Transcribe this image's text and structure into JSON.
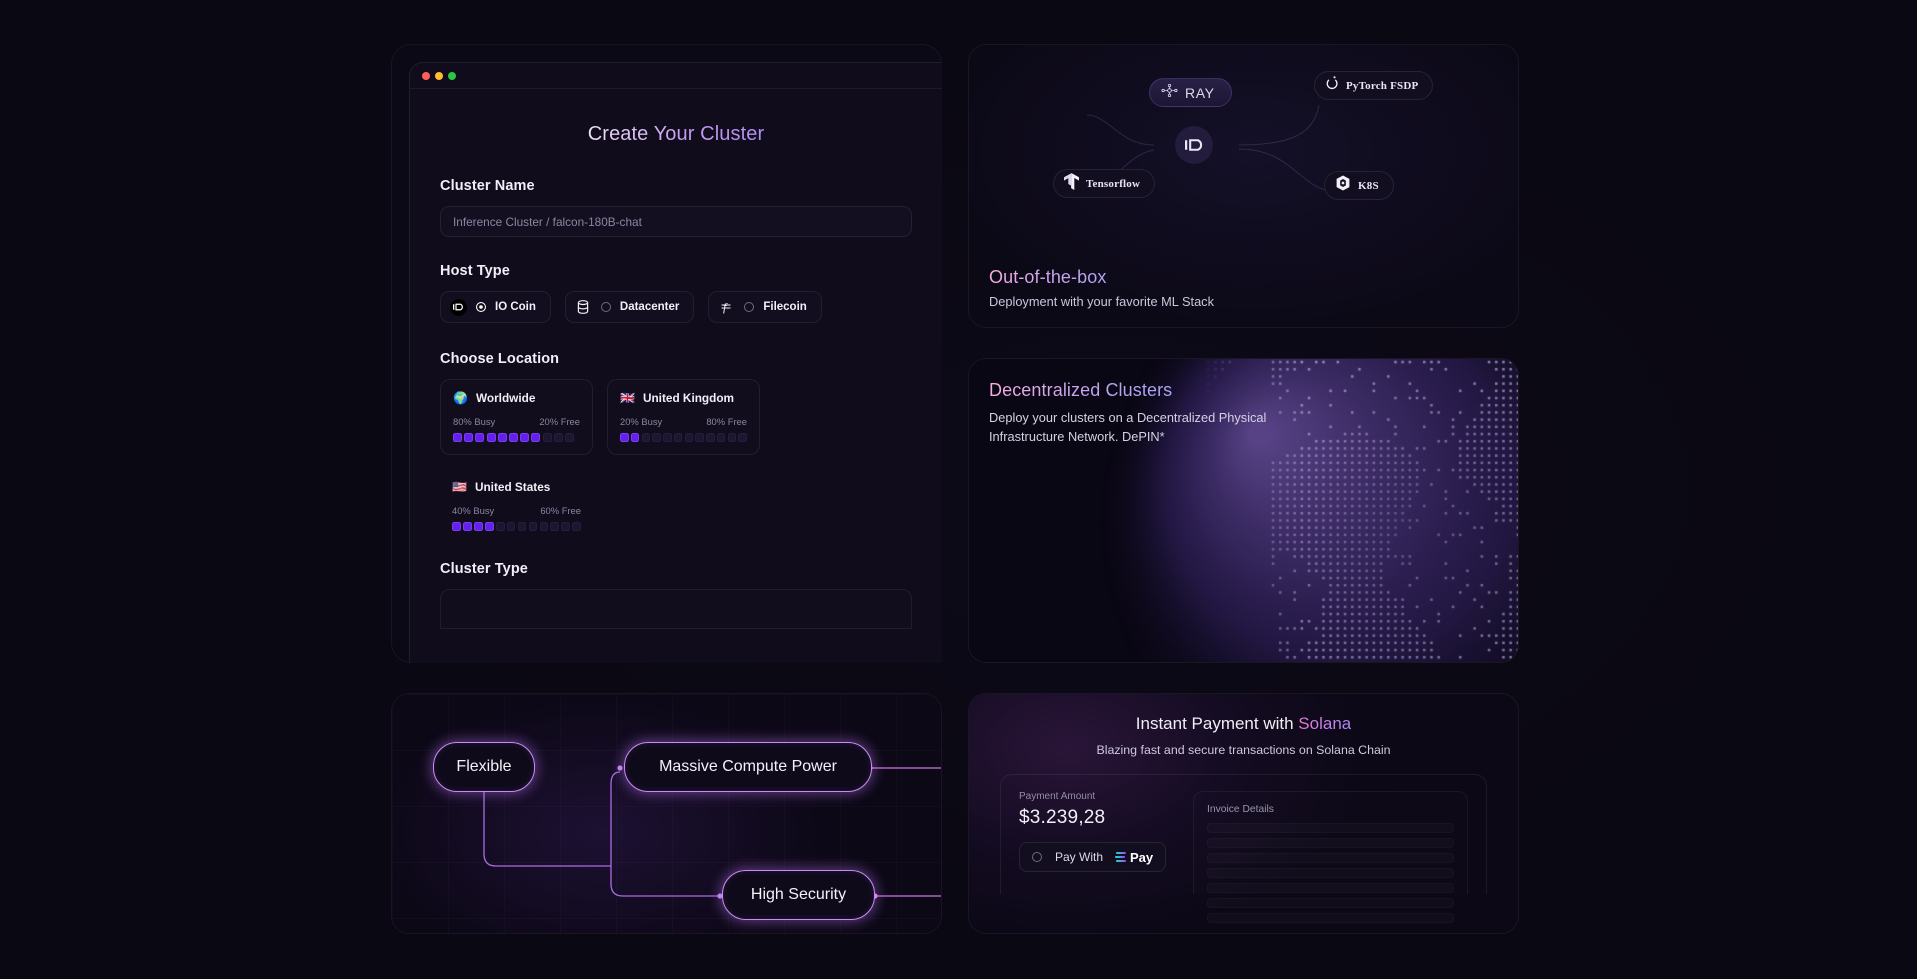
{
  "form": {
    "title_parts": [
      "Create ",
      "Your Cluster"
    ],
    "title_full": "Create Your Cluster",
    "cluster_name_label": "Cluster Name",
    "cluster_name_placeholder": "Inference Cluster / falcon-180B-chat",
    "cluster_name_value": "",
    "host_type_label": "Host Type",
    "host_types": [
      {
        "label": "IO Coin",
        "icon": "io-coin-icon",
        "selected": true
      },
      {
        "label": "Datacenter",
        "icon": "database-icon",
        "selected": false
      },
      {
        "label": "Filecoin",
        "icon": "filecoin-icon",
        "selected": false
      }
    ],
    "choose_location_label": "Choose Location",
    "locations": [
      {
        "name": "Worldwide",
        "flag": "globe-icon",
        "busy": "80% Busy",
        "free": "20% Free",
        "segments_total": 11,
        "segments_filled": 8
      },
      {
        "name": "United Kingdom",
        "flag": "flag-uk-icon",
        "busy": "20% Busy",
        "free": "80% Free",
        "segments_total": 12,
        "segments_filled": 2
      },
      {
        "name": "United States",
        "flag": "flag-us-icon",
        "busy": "40% Busy",
        "free": "60% Free",
        "segments_total": 12,
        "segments_filled": 4
      }
    ],
    "cluster_type_label": "Cluster Type"
  },
  "ml_stack": {
    "title": "Out-of-the-box",
    "subtitle": "Deployment with your favorite ML Stack",
    "center_icon": "ionet-logo-icon",
    "nodes": [
      {
        "label": "RAY",
        "icon": "ray-icon"
      },
      {
        "label": "PyTorch FSDP",
        "icon": "pytorch-icon"
      },
      {
        "label": "Tensorflow",
        "icon": "tensorflow-icon"
      },
      {
        "label": "K8S",
        "icon": "kubernetes-icon"
      }
    ]
  },
  "decentralized": {
    "title": "Decentralized Clusters",
    "subtitle_line1": "Deploy your clusters on a Decentralized Physical",
    "subtitle_line2": "Infrastructure Network. DePIN*"
  },
  "features": {
    "nodes": [
      {
        "label": "Flexible"
      },
      {
        "label": "Massive Compute Power"
      },
      {
        "label": "High Security"
      }
    ]
  },
  "solana": {
    "title_prefix": "Instant Payment with ",
    "title_accent": "Solana",
    "subtitle": "Blazing fast and secure transactions on Solana Chain",
    "payment_amount_label": "Payment Amount",
    "payment_amount": "$3.239,28",
    "pay_with_label": "Pay With",
    "pay_brand": "Pay",
    "invoice_title": "Invoice Details",
    "invoice_rows": 7
  },
  "colors": {
    "page_bg": "#0a0812",
    "card_bg": "#0d0a17",
    "accent_purple": "#6320ee",
    "node_glow": "#c98af5",
    "solana_gradient_start": "#13e6c4",
    "solana_gradient_end": "#9945ff"
  },
  "window_dots": [
    "#ff5f57",
    "#febc2e",
    "#28c840"
  ]
}
